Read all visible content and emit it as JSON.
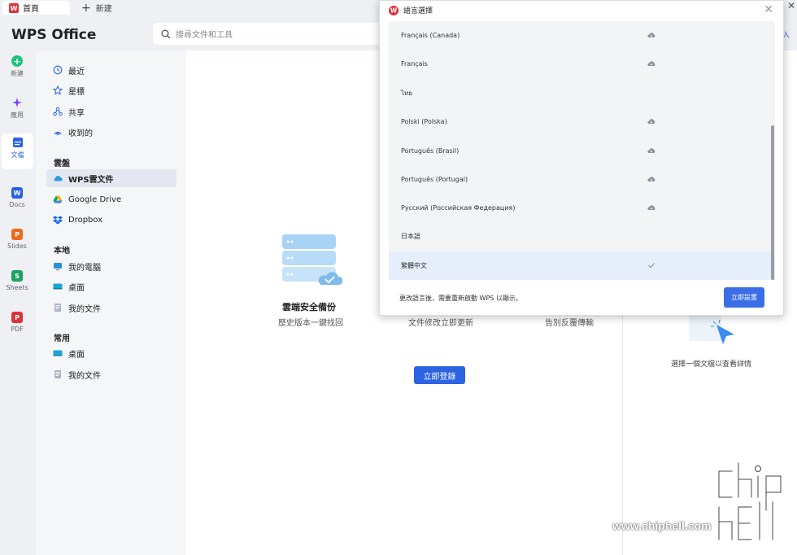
{
  "tabs": {
    "home": "首頁",
    "new": "新建"
  },
  "header": {
    "brand": "WPS Office",
    "search_placeholder": "搜尋文件和工具",
    "login_partial": "入"
  },
  "rail": [
    {
      "label": "新建",
      "icon": "plus-circle-icon",
      "color": "#1ec37a"
    },
    {
      "label": "應用",
      "icon": "sparkle-icon",
      "color": "#7a3cff"
    },
    {
      "label": "文檔",
      "icon": "document-icon",
      "color": "#2b63e0"
    },
    {
      "label": "Docs",
      "icon": "W",
      "color": "#2b63e0"
    },
    {
      "label": "Slides",
      "icon": "P",
      "color": "#f06a1d"
    },
    {
      "label": "Sheets",
      "icon": "S",
      "color": "#1aa260"
    },
    {
      "label": "PDF",
      "icon": "pdf-icon",
      "color": "#e0313a"
    }
  ],
  "nav": {
    "recent": "最近",
    "starred": "星標",
    "shared": "共享",
    "received": "收到的",
    "cloud_head": "雲盤",
    "wps_cloud": "WPS雲文件",
    "google_drive": "Google Drive",
    "dropbox": "Dropbox",
    "local_head": "本地",
    "my_computer": "我的電腦",
    "desktop": "桌面",
    "my_docs": "我的文件",
    "common_head": "常用",
    "common_desktop": "桌面",
    "common_docs": "我的文件"
  },
  "main": {
    "features": [
      {
        "title": "雲端安全備份",
        "sub": "歷史版本一鍵找回"
      },
      {
        "title": "",
        "sub": "文件修改立即更新"
      },
      {
        "title": "",
        "sub": "告別反覆傳輸"
      }
    ],
    "login_button": "立即登錄",
    "detail_hint": "選擇一個文檔以查看詳情"
  },
  "dialog": {
    "title": "語言選擇",
    "languages": [
      {
        "name": "Français (Canada)",
        "cloud": true,
        "selected": false
      },
      {
        "name": "Français",
        "cloud": true,
        "selected": false
      },
      {
        "name": "ไทย",
        "cloud": false,
        "selected": false
      },
      {
        "name": "Polski (Polska)",
        "cloud": true,
        "selected": false
      },
      {
        "name": "Português (Brasil)",
        "cloud": true,
        "selected": false
      },
      {
        "name": "Português (Portugal)",
        "cloud": true,
        "selected": false
      },
      {
        "name": "Русский (Российская Федерация)",
        "cloud": true,
        "selected": false
      },
      {
        "name": "日本語",
        "cloud": false,
        "selected": false
      },
      {
        "name": "繁體中文",
        "cloud": false,
        "selected": true
      }
    ],
    "note": "更改語言後，需要重新啟動 WPS 以顯示。",
    "apply_button": "立即設置"
  },
  "watermark": {
    "url": "www.chiphell.com",
    "logo_text": "chip hell"
  }
}
